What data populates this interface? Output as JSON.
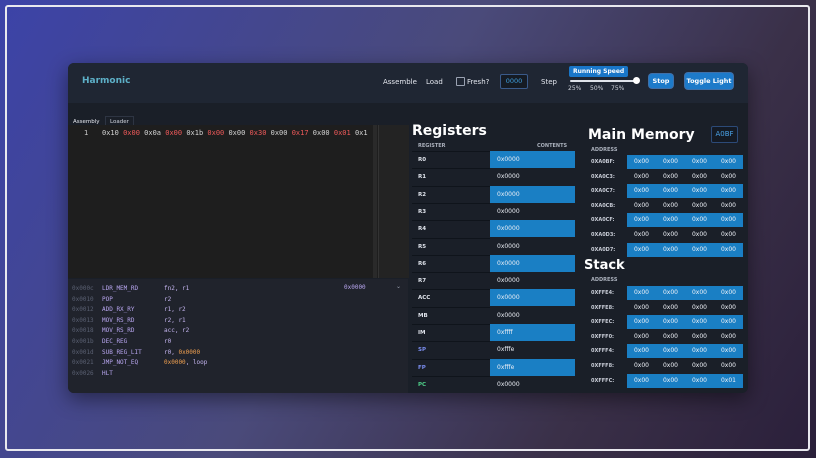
{
  "app": {
    "title": "Harmonic"
  },
  "toolbar": {
    "assemble": "Assemble",
    "load": "Load",
    "fresh": "Fresh?",
    "counter": "0000",
    "step": "Step",
    "speed_label": "Running Speed",
    "speed_ticks": [
      "25%",
      "50%",
      "75%"
    ],
    "stop": "Stop",
    "toggle_light": "Toggle Light"
  },
  "editor": {
    "tabs": [
      "Assembly",
      "Loader"
    ],
    "line_number": "1",
    "code_tokens": [
      "0x10",
      "0x00",
      "0x0a",
      "0x00",
      "0x1b",
      "0x00",
      "0x00",
      "0x30",
      "0x00",
      "0x17",
      "0x00",
      "0x01",
      "0x1"
    ]
  },
  "disassembly": {
    "selector_value": "0x0000",
    "lines": [
      {
        "addr": "0x000c",
        "op": "LDR_MEM_RD",
        "args": [
          {
            "t": "fn2, r1",
            "num": false
          }
        ]
      },
      {
        "addr": "0x0010",
        "op": "POP",
        "args": [
          {
            "t": "r2",
            "num": false
          }
        ]
      },
      {
        "addr": "0x0012",
        "op": "ADD_RX_RY",
        "args": [
          {
            "t": "r1, r2",
            "num": false
          }
        ]
      },
      {
        "addr": "0x0013",
        "op": "MOV_RS_RD",
        "args": [
          {
            "t": "r2, r1",
            "num": false
          }
        ]
      },
      {
        "addr": "0x0018",
        "op": "MOV_RS_RD",
        "args": [
          {
            "t": "acc, r2",
            "num": false
          }
        ]
      },
      {
        "addr": "0x001b",
        "op": "DEC_REG",
        "args": [
          {
            "t": "r0",
            "num": false
          }
        ]
      },
      {
        "addr": "0x001d",
        "op": "SUB_REG_LIT",
        "args": [
          {
            "t": "r0, ",
            "num": false
          },
          {
            "t": "0x0000",
            "num": true
          }
        ]
      },
      {
        "addr": "0x0021",
        "op": "JMP_NOT_EQ",
        "args": [
          {
            "t": "0x0000",
            "num": true
          },
          {
            "t": ", loop",
            "num": false
          }
        ]
      },
      {
        "addr": "0x0026",
        "op": "HLT",
        "args": []
      }
    ]
  },
  "registers": {
    "title": "Registers",
    "col_register": "REGISTER",
    "col_contents": "CONTENTS",
    "rows": [
      {
        "name": "R0",
        "value": "0x0000",
        "hl": true,
        "color": "#e0e4ec"
      },
      {
        "name": "R1",
        "value": "0x0000",
        "hl": false,
        "color": "#e0e4ec"
      },
      {
        "name": "R2",
        "value": "0x0000",
        "hl": true,
        "color": "#e0e4ec"
      },
      {
        "name": "R3",
        "value": "0x0000",
        "hl": false,
        "color": "#e0e4ec"
      },
      {
        "name": "R4",
        "value": "0x0000",
        "hl": true,
        "color": "#e0e4ec"
      },
      {
        "name": "R5",
        "value": "0x0000",
        "hl": false,
        "color": "#e0e4ec"
      },
      {
        "name": "R6",
        "value": "0x0000",
        "hl": true,
        "color": "#e0e4ec"
      },
      {
        "name": "R7",
        "value": "0x0000",
        "hl": false,
        "color": "#e0e4ec"
      },
      {
        "name": "ACC",
        "value": "0x0000",
        "hl": true,
        "color": "#e0e4ec"
      },
      {
        "name": "MB",
        "value": "0x0000",
        "hl": false,
        "color": "#e0e4ec"
      },
      {
        "name": "IM",
        "value": "0xffff",
        "hl": true,
        "color": "#e0e4ec"
      },
      {
        "name": "SP",
        "value": "0xfffe",
        "hl": false,
        "color": "#7b8ef0"
      },
      {
        "name": "FP",
        "value": "0xfffe",
        "hl": true,
        "color": "#7b8ef0"
      },
      {
        "name": "PC",
        "value": "0x0000",
        "hl": false,
        "color": "#4fd08a"
      }
    ]
  },
  "memory": {
    "title": "Main Memory",
    "badge": "A0BF",
    "col_address": "ADDRESS",
    "rows": [
      {
        "addr": "0XA0BF:",
        "cells": [
          "0x00",
          "0x00",
          "0x00",
          "0x00"
        ],
        "hl": true
      },
      {
        "addr": "0XA0C3:",
        "cells": [
          "0x00",
          "0x00",
          "0x00",
          "0x00"
        ],
        "hl": false
      },
      {
        "addr": "0XA0C7:",
        "cells": [
          "0x00",
          "0x00",
          "0x00",
          "0x00"
        ],
        "hl": true
      },
      {
        "addr": "0XA0CB:",
        "cells": [
          "0x00",
          "0x00",
          "0x00",
          "0x00"
        ],
        "hl": false
      },
      {
        "addr": "0XA0CF:",
        "cells": [
          "0x00",
          "0x00",
          "0x00",
          "0x00"
        ],
        "hl": true
      },
      {
        "addr": "0XA0D3:",
        "cells": [
          "0x00",
          "0x00",
          "0x00",
          "0x00"
        ],
        "hl": false
      },
      {
        "addr": "0XA0D7:",
        "cells": [
          "0x00",
          "0x00",
          "0x00",
          "0x00"
        ],
        "hl": true
      }
    ]
  },
  "stack": {
    "title": "Stack",
    "col_address": "ADDRESS",
    "rows": [
      {
        "addr": "0XFFE4:",
        "cells": [
          "0x00",
          "0x00",
          "0x00",
          "0x00"
        ],
        "hl": true
      },
      {
        "addr": "0XFFE8:",
        "cells": [
          "0x00",
          "0x00",
          "0x00",
          "0x00"
        ],
        "hl": false
      },
      {
        "addr": "0XFFEC:",
        "cells": [
          "0x00",
          "0x00",
          "0x00",
          "0x00"
        ],
        "hl": true
      },
      {
        "addr": "0XFFF0:",
        "cells": [
          "0x00",
          "0x00",
          "0x00",
          "0x00"
        ],
        "hl": false
      },
      {
        "addr": "0XFFF4:",
        "cells": [
          "0x00",
          "0x00",
          "0x00",
          "0x00"
        ],
        "hl": true
      },
      {
        "addr": "0XFFF8:",
        "cells": [
          "0x00",
          "0x00",
          "0x00",
          "0x00"
        ],
        "hl": false
      },
      {
        "addr": "0XFFFC:",
        "cells": [
          "0x00",
          "0x00",
          "0x00",
          "0x01"
        ],
        "hl": true
      }
    ]
  },
  "colors": {
    "accent": "#1a7fc4",
    "row_dark": "#1a1f28"
  }
}
